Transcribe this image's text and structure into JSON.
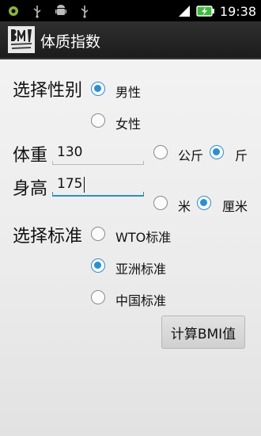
{
  "status_bar": {
    "time": "19:38",
    "icons": [
      "android-debug-icon",
      "usb-icon",
      "android-robot-icon",
      "usb-icon",
      "signal-icon",
      "battery-charging-icon"
    ],
    "accent_color": "#2b8fd0"
  },
  "action_bar": {
    "icon": "bmi-app-icon",
    "title": "体质指数"
  },
  "gender": {
    "label": "选择性别",
    "options": [
      {
        "label": "男性",
        "selected": true
      },
      {
        "label": "女性",
        "selected": false
      }
    ]
  },
  "weight": {
    "label": "体重",
    "value": "130",
    "units": [
      {
        "label": "公斤",
        "selected": false
      },
      {
        "label": "斤",
        "selected": true
      }
    ]
  },
  "height": {
    "label": "身高",
    "value": "175",
    "units": [
      {
        "label": "米",
        "selected": false
      },
      {
        "label": "厘米",
        "selected": true
      }
    ]
  },
  "standard": {
    "label": "选择标准",
    "options": [
      {
        "label": "WTO标准",
        "selected": false
      },
      {
        "label": "亚洲标准",
        "selected": true
      },
      {
        "label": "中国标准",
        "selected": false
      }
    ]
  },
  "calculate_button": {
    "label": "计算BMI值"
  }
}
